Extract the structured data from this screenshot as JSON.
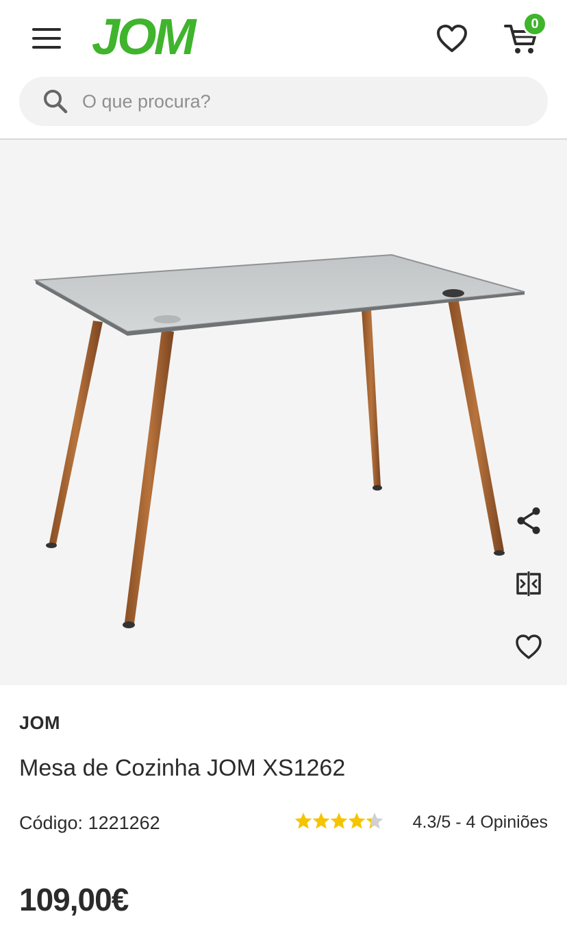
{
  "header": {
    "logo_text": "JOM",
    "cart_count": "0",
    "brand_color": "#3fb42c"
  },
  "search": {
    "placeholder": "O que procura?",
    "value": ""
  },
  "gallery": {
    "icons": [
      "share-icon",
      "compare-icon",
      "heart-icon"
    ]
  },
  "product": {
    "brand": "JOM",
    "title": "Mesa de Cozinha JOM XS1262",
    "code": "Código: 1221262",
    "rating_value": 4.3,
    "rating_max": 5,
    "rating_text": "4.3/5 - 4 Opiniões",
    "price": "109,00€",
    "star_color": "#f5c400"
  }
}
